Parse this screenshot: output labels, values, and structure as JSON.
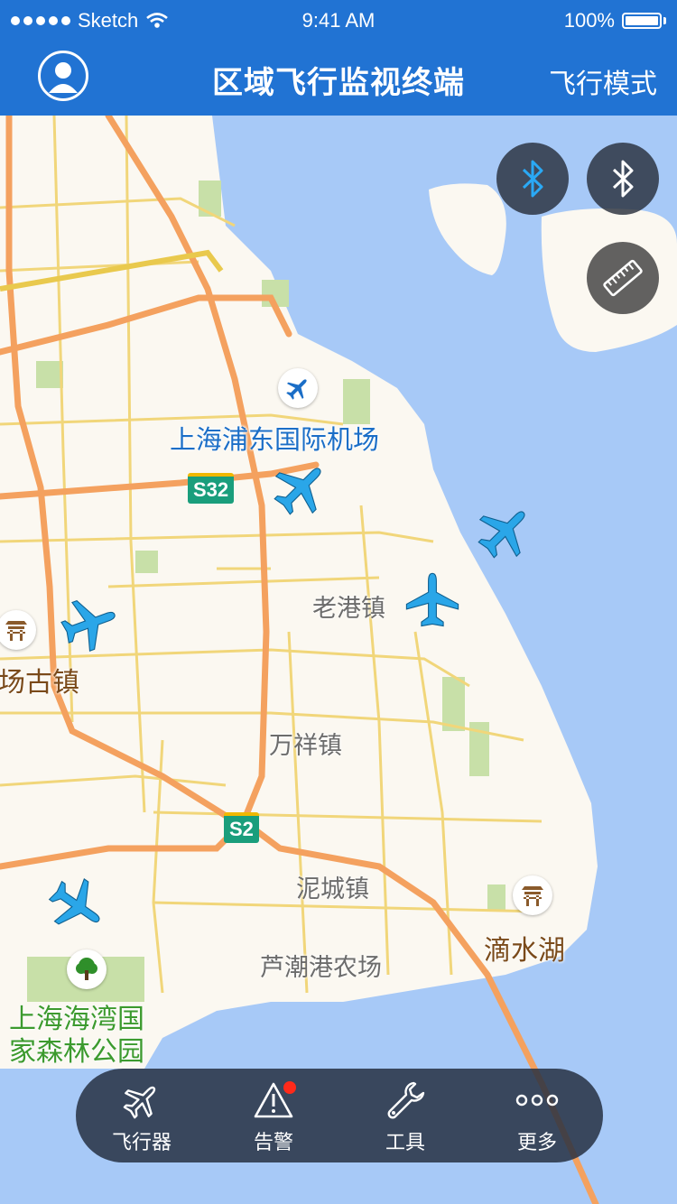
{
  "status_bar": {
    "carrier": "Sketch",
    "time": "9:41 AM",
    "battery": "100%"
  },
  "nav": {
    "title": "区域飞行监视终端",
    "mode_label": "飞行模式"
  },
  "map_labels": {
    "airport": "上海浦东国际机场",
    "laogang": "老港镇",
    "wanxiang": "万祥镇",
    "nicheng": "泥城镇",
    "luchaogang": "芦潮港农场",
    "dishuihu": "滴水湖",
    "gu_town": "场古镇",
    "forest_line1": "上海海湾国",
    "forest_line2": "家森林公园"
  },
  "road_shields": {
    "s32": "S32",
    "s2": "S2"
  },
  "tabs": [
    {
      "label": "飞行器",
      "icon": "plane-icon"
    },
    {
      "label": "告警",
      "icon": "warning-icon",
      "badge": true
    },
    {
      "label": "工具",
      "icon": "wrench-icon"
    },
    {
      "label": "更多",
      "icon": "more-icon"
    }
  ],
  "floating_buttons": [
    {
      "icon": "bluetooth-icon",
      "color": "#2aa9f5",
      "state": "active"
    },
    {
      "icon": "bluetooth-icon",
      "color": "#ffffff",
      "state": "inactive"
    },
    {
      "icon": "ruler-icon",
      "color": "#ffffff"
    }
  ],
  "colors": {
    "brand": "#2173d3",
    "sea": "#a7c9f7",
    "land": "#fbf8f1",
    "expressway": "#f4a15f",
    "aircraft": "#2aa6e8",
    "alert_badge": "#ff2a1a"
  }
}
